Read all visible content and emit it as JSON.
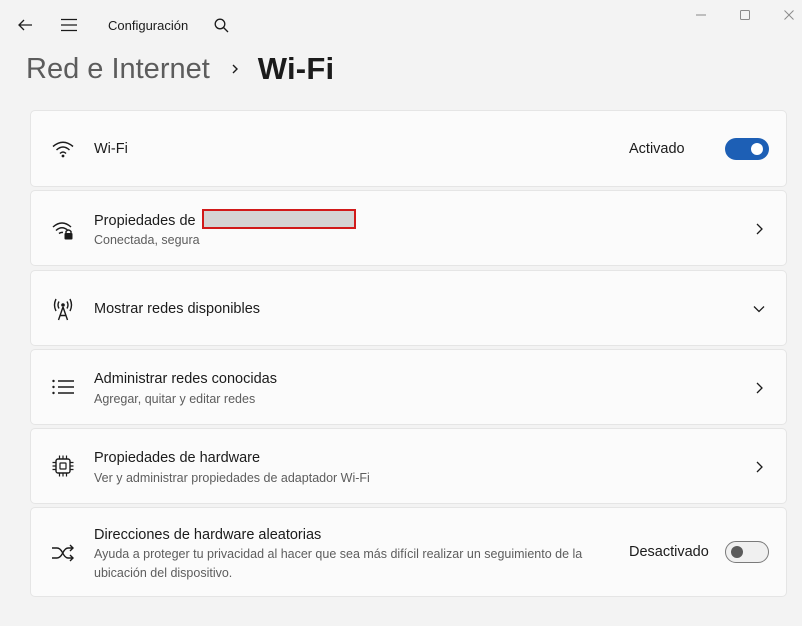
{
  "app": {
    "title": "Configuración"
  },
  "breadcrumb": {
    "parent": "Red e Internet",
    "current": "Wi-Fi"
  },
  "wifi": {
    "label": "Wi-Fi",
    "state_label": "Activado",
    "enabled": true,
    "icon": "wifi-icon"
  },
  "properties": {
    "label_prefix": "Propiedades de",
    "network_name_redacted": "",
    "subtitle": "Conectada, segura",
    "icon": "wifi-lock-icon"
  },
  "available": {
    "label": "Mostrar redes disponibles",
    "icon": "antenna-icon"
  },
  "known": {
    "label": "Administrar redes conocidas",
    "subtitle": "Agregar, quitar y editar redes",
    "icon": "list-icon"
  },
  "hardware": {
    "label": "Propiedades de hardware",
    "subtitle": "Ver y administrar propiedades de adaptador Wi-Fi",
    "icon": "chip-icon"
  },
  "random_mac": {
    "label": "Direcciones de hardware aleatorias",
    "subtitle": "Ayuda a proteger tu privacidad al hacer que sea más difícil realizar un seguimiento de la ubicación del dispositivo.",
    "state_label": "Desactivado",
    "enabled": false,
    "icon": "shuffle-icon"
  },
  "colors": {
    "accent": "#1d5fb5",
    "background": "#f3f3f3",
    "card": "#fbfbfb",
    "redaction_border": "#d11a1a"
  }
}
